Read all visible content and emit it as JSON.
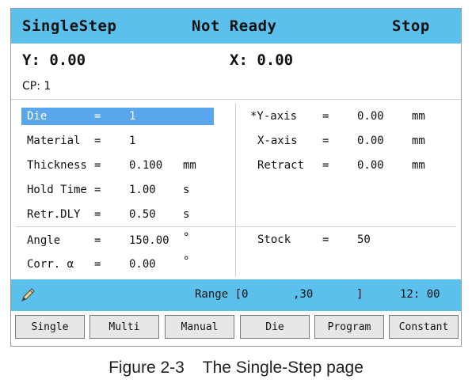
{
  "header": {
    "mode": "SingleStep",
    "status": "Not Ready",
    "action": "Stop"
  },
  "position": {
    "y": "Y: 0.00",
    "x": "X: 0.00",
    "cp": "CP: 1"
  },
  "left_params": [
    {
      "label": "Die",
      "eq": "=",
      "value": "1",
      "unit": "",
      "selected": true
    },
    {
      "label": "Material",
      "eq": "=",
      "value": "1",
      "unit": ""
    },
    {
      "label": "Thickness",
      "eq": "=",
      "value": "0.100",
      "unit": "mm"
    },
    {
      "label": "Hold Time",
      "eq": "=",
      "value": "1.00",
      "unit": "s"
    },
    {
      "label": "Retr.DLY",
      "eq": "=",
      "value": "0.50",
      "unit": "s"
    },
    {
      "label": "Angle",
      "eq": "=",
      "value": "150.00",
      "unit": "°"
    },
    {
      "label": "Corr. α",
      "eq": "=",
      "value": "0.00",
      "unit": "°"
    }
  ],
  "right_params": [
    {
      "label": "*Y-axis",
      "eq": "=",
      "value": "0.00",
      "unit": "mm"
    },
    {
      "label": "X-axis",
      "eq": "=",
      "value": "0.00",
      "unit": "mm"
    },
    {
      "label": "Retract",
      "eq": "=",
      "value": "0.00",
      "unit": "mm"
    },
    {
      "label": "Stock",
      "eq": "=",
      "value": "50",
      "unit": ""
    }
  ],
  "status_bar": {
    "icon": "pencil-icon",
    "range_label": "Range [0",
    "range_sep": ",30",
    "range_close": "]",
    "time": "12: 00"
  },
  "buttons": [
    "Single",
    "Multi",
    "Manual",
    "Die",
    "Program",
    "Constant"
  ],
  "caption": "Figure 2-3    The Single-Step page",
  "colors": {
    "bar": "#5bc0eb",
    "selection": "#5aa6ec",
    "button": "#e7e7e7"
  }
}
